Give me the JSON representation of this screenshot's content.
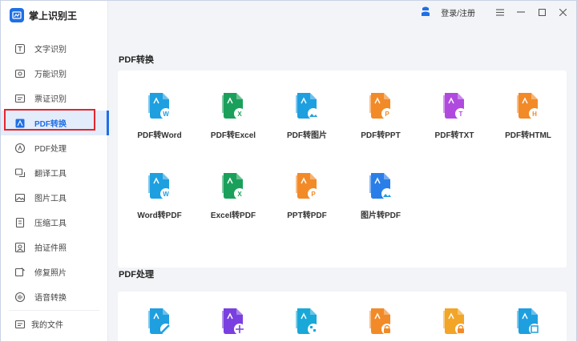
{
  "app": {
    "name": "掌上识别王",
    "login_label": "登录/注册"
  },
  "sidebar": {
    "items": [
      {
        "label": "文字识别",
        "icon": "text-scan-icon"
      },
      {
        "label": "万能识别",
        "icon": "universal-scan-icon"
      },
      {
        "label": "票证识别",
        "icon": "ticket-scan-icon"
      },
      {
        "label": "PDF转换",
        "icon": "pdf-convert-icon",
        "active": true
      },
      {
        "label": "PDF处理",
        "icon": "pdf-process-icon"
      },
      {
        "label": "翻译工具",
        "icon": "translate-icon"
      },
      {
        "label": "图片工具",
        "icon": "image-tool-icon"
      },
      {
        "label": "压缩工具",
        "icon": "compress-icon"
      },
      {
        "label": "拍证件照",
        "icon": "id-photo-icon"
      },
      {
        "label": "修复照片",
        "icon": "photo-repair-icon"
      },
      {
        "label": "语音转换",
        "icon": "voice-convert-icon"
      }
    ],
    "my_files": "我的文件"
  },
  "sections": {
    "pdf_convert": {
      "title": "PDF转换",
      "tools": [
        {
          "label": "PDF转Word",
          "color": "#1e9fe0",
          "badge": "W"
        },
        {
          "label": "PDF转Excel",
          "color": "#1aa05a",
          "badge": "X"
        },
        {
          "label": "PDF转图片",
          "color": "#1e9fe0",
          "badge": "img"
        },
        {
          "label": "PDF转PPT",
          "color": "#f28a28",
          "badge": "P"
        },
        {
          "label": "PDF转TXT",
          "color": "#b04adf",
          "badge": "T"
        },
        {
          "label": "PDF转HTML",
          "color": "#f28a28",
          "badge": "H"
        },
        {
          "label": "Word转PDF",
          "color": "#1e9fe0",
          "badge": "W"
        },
        {
          "label": "Excel转PDF",
          "color": "#1aa05a",
          "badge": "X"
        },
        {
          "label": "PPT转PDF",
          "color": "#f28a28",
          "badge": "P"
        },
        {
          "label": "图片转PDF",
          "color": "#2a7ee8",
          "badge": "img"
        }
      ]
    },
    "pdf_process": {
      "title": "PDF处理",
      "tools": [
        {
          "color": "#1e9fe0",
          "badge": "edit"
        },
        {
          "color": "#7a3fe0",
          "badge": "move"
        },
        {
          "color": "#19a8d8",
          "badge": "split"
        },
        {
          "color": "#f28a28",
          "badge": "lock"
        },
        {
          "color": "#f2a528",
          "badge": "unlock"
        },
        {
          "color": "#1e9fe0",
          "badge": "compress"
        }
      ]
    }
  }
}
